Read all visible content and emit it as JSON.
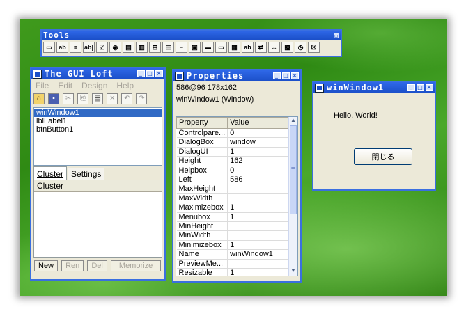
{
  "tools": {
    "title": "Tools",
    "icons": [
      {
        "name": "label-tool-icon",
        "glyph": "▭"
      },
      {
        "name": "text-tool-icon",
        "glyph": "ab"
      },
      {
        "name": "list-tool-icon",
        "glyph": "≡"
      },
      {
        "name": "edit-tool-icon",
        "glyph": "ab|"
      },
      {
        "name": "checkbox-tool-icon",
        "glyph": "☑"
      },
      {
        "name": "radio-tool-icon",
        "glyph": "◉"
      },
      {
        "name": "listview-tool-icon",
        "glyph": "▤"
      },
      {
        "name": "combo-tool-icon",
        "glyph": "▥"
      },
      {
        "name": "tree-tool-icon",
        "glyph": "⊞"
      },
      {
        "name": "menu-tool-icon",
        "glyph": "☰"
      },
      {
        "name": "frame-tool-icon",
        "glyph": "⌐"
      },
      {
        "name": "tab-tool-icon",
        "glyph": "▣"
      },
      {
        "name": "progress-tool-icon",
        "glyph": "▬"
      },
      {
        "name": "status-tool-icon",
        "glyph": "▭"
      },
      {
        "name": "image-tool-icon",
        "glyph": "▦"
      },
      {
        "name": "rich-text-tool-icon",
        "glyph": "ab"
      },
      {
        "name": "slider-tool-icon",
        "glyph": "⇄"
      },
      {
        "name": "updown-tool-icon",
        "glyph": "↔"
      },
      {
        "name": "grid-tool-icon",
        "glyph": "▩"
      },
      {
        "name": "timer-tool-icon",
        "glyph": "◷"
      },
      {
        "name": "close-tool-icon",
        "glyph": "☒"
      }
    ]
  },
  "loft": {
    "title": "The GUI Loft",
    "menu": [
      "File",
      "Edit",
      "Design",
      "Help"
    ],
    "tree": [
      "winWindow1",
      "lblLabel1",
      "btnButton1"
    ],
    "selected_index": 0,
    "tabs": [
      "Cluster",
      "Settings"
    ],
    "cluster_header": "Cluster",
    "buttons": [
      "New",
      "Ren",
      "Del",
      "Memorize"
    ]
  },
  "properties": {
    "title": "Properties",
    "info_line1": "586@96 178x162",
    "info_line2": "winWindow1 (Window)",
    "col_property": "Property",
    "col_value": "Value",
    "rows": [
      [
        "Controlpare...",
        "0"
      ],
      [
        "DialogBox",
        "window"
      ],
      [
        "DialogUI",
        "1"
      ],
      [
        "Height",
        "162"
      ],
      [
        "Helpbox",
        "0"
      ],
      [
        "Left",
        "586"
      ],
      [
        "MaxHeight",
        ""
      ],
      [
        "MaxWidth",
        ""
      ],
      [
        "Maximizebox",
        "1"
      ],
      [
        "Menubox",
        "1"
      ],
      [
        "MinHeight",
        ""
      ],
      [
        "MinWidth",
        ""
      ],
      [
        "Minimizebox",
        "1"
      ],
      [
        "Name",
        "winWindow1"
      ],
      [
        "PreviewMe...",
        ""
      ],
      [
        "Resizable",
        "1"
      ]
    ]
  },
  "preview": {
    "title": "winWindow1",
    "label": "Hello, World!",
    "button": "閉じる"
  },
  "colors": {
    "titlebar": "#1b4fc8",
    "desktop": "#3f9a1c",
    "selection": "#316ac5"
  }
}
